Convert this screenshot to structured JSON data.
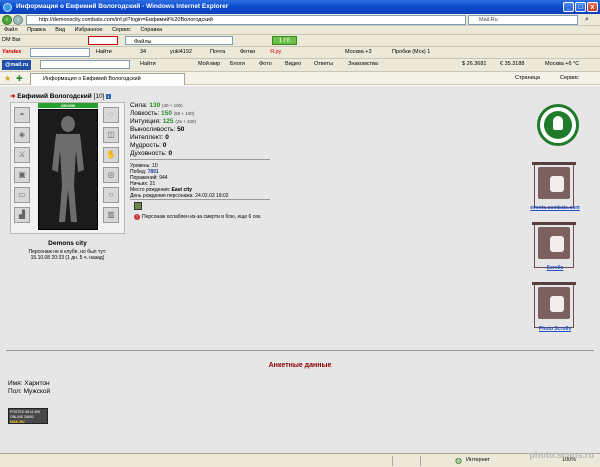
{
  "window": {
    "title": "Информация о Евфимий Вологодский - Windows Internet Explorer",
    "buttons": [
      "_",
      "□",
      "x"
    ]
  },
  "addressbar": {
    "url": "http://demonscity.combats.com/inf.pl?login=Евфимий%20Вологодский",
    "search_placeholder": "Mail.Ru"
  },
  "menu": [
    "Файл",
    "Правка",
    "Вид",
    "Избранное",
    "Сервис",
    "Справка"
  ],
  "toolbar1": {
    "left_label": "DM Bar",
    "dropdown": "Файлы",
    "counter": "1 Гб"
  },
  "toolbar2": {
    "brand": "Yandex",
    "find": "Найти",
    "num": "34",
    "user": "yukl4192",
    "mail": "Почта",
    "photos": "Фотки",
    "ya": "Я.ру",
    "weather": "Москва +3",
    "traffic": "Пробки (Мск) 1"
  },
  "toolbar3": {
    "brand": "@mail.ru",
    "find": "Найти",
    "links": [
      "Мой мир",
      "Блоги",
      "Фото",
      "Видео",
      "Ответы",
      "Знакомства"
    ],
    "usd": "$ 26.3681",
    "eur": "€ 35.3188",
    "weather": "Москва +6 °С"
  },
  "tab": {
    "title": "Информация о Евфимий Вологодский",
    "page_menu": "Страница",
    "tools_menu": "Сервис"
  },
  "character": {
    "name": "Евфимий Вологодский",
    "level": "[10]",
    "hp": "430/430",
    "city": "Demons city",
    "presence_note": "Персонаж не в клубе, но был тут:",
    "last_seen": "15.10.08 20:33 (1 дн. 5 ч. назад)"
  },
  "stats": [
    {
      "label": "Сила:",
      "value": "130",
      "suffix": "(30 + 100)"
    },
    {
      "label": "Ловкость:",
      "value": "150",
      "suffix": "(50 + 100)"
    },
    {
      "label": "Интуиция:",
      "value": "125",
      "suffix": "(25 + 100)"
    },
    {
      "label": "Выносливость:",
      "value": "50",
      "suffix": ""
    },
    {
      "label": "Интеллект:",
      "value": "0",
      "suffix": ""
    },
    {
      "label": "Мудрость:",
      "value": "0",
      "suffix": ""
    },
    {
      "label": "Духовность:",
      "value": "0",
      "suffix": ""
    }
  ],
  "details": [
    {
      "label": "Уровень:",
      "value": "10"
    },
    {
      "label": "Побед:",
      "value": "7891"
    },
    {
      "label": "Поражений:",
      "value": "944"
    },
    {
      "label": "Ничьих:",
      "value": "21"
    },
    {
      "label": "Место рождения:",
      "value": "East city"
    },
    {
      "label": "День рождения персонажа:",
      "value": "24.02.03 18:02"
    }
  ],
  "notice": "Персонаж ослаблен из-за смерти в бою, еще 6 сек.",
  "sidebar": {
    "link1": "events.combats.com",
    "link2": "Scrolls",
    "link3": "Photo Scrolls"
  },
  "profile": {
    "heading": "Анкетные данные",
    "name_label": "Имя:",
    "name_value": "Харитон",
    "gender_label": "Пол:",
    "gender_value": "Мужской"
  },
  "counter": {
    "line1": "POSTED 5614 496",
    "line2": "ONLINE 26692",
    "line3": "MAIL.RU"
  },
  "status": {
    "zone": "Интернет",
    "zoom": "100%"
  },
  "watermark": "photo.scans.ru",
  "colors": {
    "title_bar": "#0a4bd0",
    "hp_green": "#27a12e",
    "stat_green": "#2a8a2a",
    "heading_red": "#8b0000",
    "link_blue": "#1e50c8"
  }
}
